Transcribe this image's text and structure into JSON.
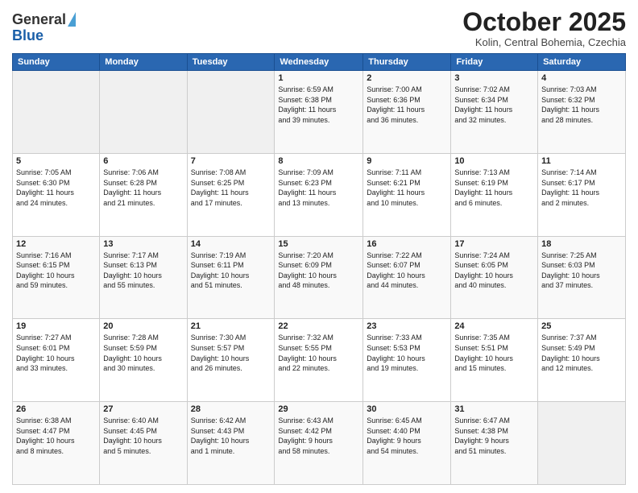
{
  "header": {
    "logo_general": "General",
    "logo_blue": "Blue",
    "month_title": "October 2025",
    "location": "Kolin, Central Bohemia, Czechia"
  },
  "days_of_week": [
    "Sunday",
    "Monday",
    "Tuesday",
    "Wednesday",
    "Thursday",
    "Friday",
    "Saturday"
  ],
  "weeks": [
    [
      {
        "day": "",
        "info": ""
      },
      {
        "day": "",
        "info": ""
      },
      {
        "day": "",
        "info": ""
      },
      {
        "day": "1",
        "info": "Sunrise: 6:59 AM\nSunset: 6:38 PM\nDaylight: 11 hours\nand 39 minutes."
      },
      {
        "day": "2",
        "info": "Sunrise: 7:00 AM\nSunset: 6:36 PM\nDaylight: 11 hours\nand 36 minutes."
      },
      {
        "day": "3",
        "info": "Sunrise: 7:02 AM\nSunset: 6:34 PM\nDaylight: 11 hours\nand 32 minutes."
      },
      {
        "day": "4",
        "info": "Sunrise: 7:03 AM\nSunset: 6:32 PM\nDaylight: 11 hours\nand 28 minutes."
      }
    ],
    [
      {
        "day": "5",
        "info": "Sunrise: 7:05 AM\nSunset: 6:30 PM\nDaylight: 11 hours\nand 24 minutes."
      },
      {
        "day": "6",
        "info": "Sunrise: 7:06 AM\nSunset: 6:28 PM\nDaylight: 11 hours\nand 21 minutes."
      },
      {
        "day": "7",
        "info": "Sunrise: 7:08 AM\nSunset: 6:25 PM\nDaylight: 11 hours\nand 17 minutes."
      },
      {
        "day": "8",
        "info": "Sunrise: 7:09 AM\nSunset: 6:23 PM\nDaylight: 11 hours\nand 13 minutes."
      },
      {
        "day": "9",
        "info": "Sunrise: 7:11 AM\nSunset: 6:21 PM\nDaylight: 11 hours\nand 10 minutes."
      },
      {
        "day": "10",
        "info": "Sunrise: 7:13 AM\nSunset: 6:19 PM\nDaylight: 11 hours\nand 6 minutes."
      },
      {
        "day": "11",
        "info": "Sunrise: 7:14 AM\nSunset: 6:17 PM\nDaylight: 11 hours\nand 2 minutes."
      }
    ],
    [
      {
        "day": "12",
        "info": "Sunrise: 7:16 AM\nSunset: 6:15 PM\nDaylight: 10 hours\nand 59 minutes."
      },
      {
        "day": "13",
        "info": "Sunrise: 7:17 AM\nSunset: 6:13 PM\nDaylight: 10 hours\nand 55 minutes."
      },
      {
        "day": "14",
        "info": "Sunrise: 7:19 AM\nSunset: 6:11 PM\nDaylight: 10 hours\nand 51 minutes."
      },
      {
        "day": "15",
        "info": "Sunrise: 7:20 AM\nSunset: 6:09 PM\nDaylight: 10 hours\nand 48 minutes."
      },
      {
        "day": "16",
        "info": "Sunrise: 7:22 AM\nSunset: 6:07 PM\nDaylight: 10 hours\nand 44 minutes."
      },
      {
        "day": "17",
        "info": "Sunrise: 7:24 AM\nSunset: 6:05 PM\nDaylight: 10 hours\nand 40 minutes."
      },
      {
        "day": "18",
        "info": "Sunrise: 7:25 AM\nSunset: 6:03 PM\nDaylight: 10 hours\nand 37 minutes."
      }
    ],
    [
      {
        "day": "19",
        "info": "Sunrise: 7:27 AM\nSunset: 6:01 PM\nDaylight: 10 hours\nand 33 minutes."
      },
      {
        "day": "20",
        "info": "Sunrise: 7:28 AM\nSunset: 5:59 PM\nDaylight: 10 hours\nand 30 minutes."
      },
      {
        "day": "21",
        "info": "Sunrise: 7:30 AM\nSunset: 5:57 PM\nDaylight: 10 hours\nand 26 minutes."
      },
      {
        "day": "22",
        "info": "Sunrise: 7:32 AM\nSunset: 5:55 PM\nDaylight: 10 hours\nand 22 minutes."
      },
      {
        "day": "23",
        "info": "Sunrise: 7:33 AM\nSunset: 5:53 PM\nDaylight: 10 hours\nand 19 minutes."
      },
      {
        "day": "24",
        "info": "Sunrise: 7:35 AM\nSunset: 5:51 PM\nDaylight: 10 hours\nand 15 minutes."
      },
      {
        "day": "25",
        "info": "Sunrise: 7:37 AM\nSunset: 5:49 PM\nDaylight: 10 hours\nand 12 minutes."
      }
    ],
    [
      {
        "day": "26",
        "info": "Sunrise: 6:38 AM\nSunset: 4:47 PM\nDaylight: 10 hours\nand 8 minutes."
      },
      {
        "day": "27",
        "info": "Sunrise: 6:40 AM\nSunset: 4:45 PM\nDaylight: 10 hours\nand 5 minutes."
      },
      {
        "day": "28",
        "info": "Sunrise: 6:42 AM\nSunset: 4:43 PM\nDaylight: 10 hours\nand 1 minute."
      },
      {
        "day": "29",
        "info": "Sunrise: 6:43 AM\nSunset: 4:42 PM\nDaylight: 9 hours\nand 58 minutes."
      },
      {
        "day": "30",
        "info": "Sunrise: 6:45 AM\nSunset: 4:40 PM\nDaylight: 9 hours\nand 54 minutes."
      },
      {
        "day": "31",
        "info": "Sunrise: 6:47 AM\nSunset: 4:38 PM\nDaylight: 9 hours\nand 51 minutes."
      },
      {
        "day": "",
        "info": ""
      }
    ]
  ]
}
